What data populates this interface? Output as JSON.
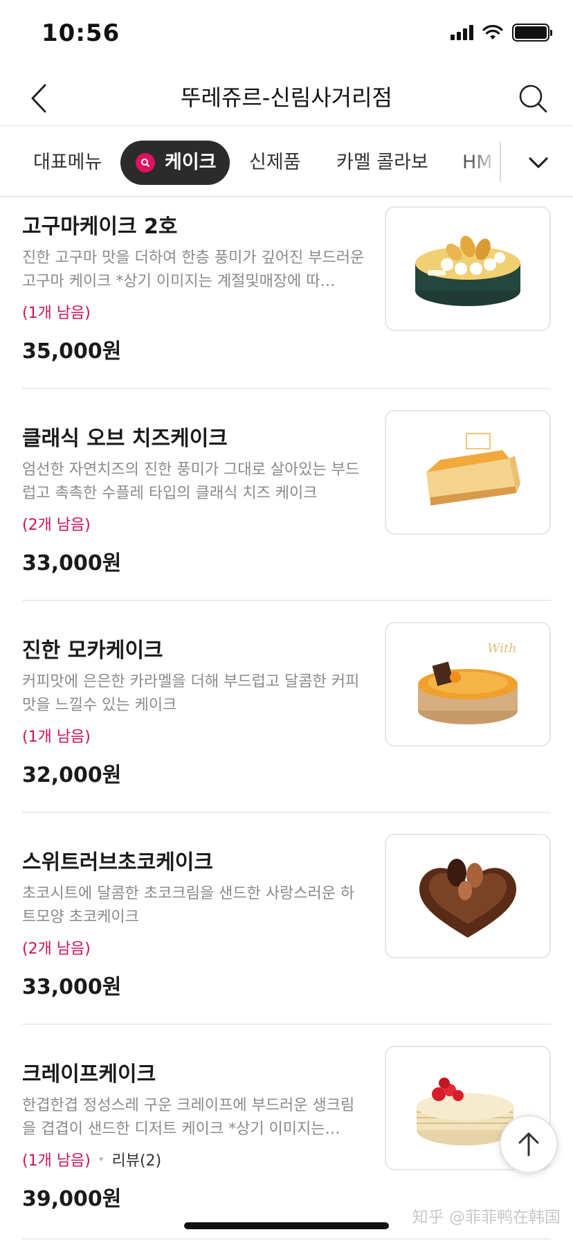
{
  "status_bar": {
    "time": "10:56"
  },
  "header": {
    "title": "뚜레쥬르-신림사거리점"
  },
  "tabs": [
    {
      "label": "대표메뉴"
    },
    {
      "label": "케이크"
    },
    {
      "label": "신제품"
    },
    {
      "label": "카멜 콜라보"
    },
    {
      "label": "HM"
    }
  ],
  "items": [
    {
      "name": "고구마케이크 2호",
      "desc": "진한 고구마 맛을 더하여 한층 풍미가 깊어진 부드러운 고구마 케이크 *상기 이미지는 계절및매장에 따…",
      "stock": "(1개 남음)",
      "price": "35,000원"
    },
    {
      "name": "클래식 오브 치즈케이크",
      "desc": "엄선한 자연치즈의 진한 풍미가 그대로 살아있는 부드럽고 촉촉한 수플레 타입의 클래식 치즈 케이크",
      "stock": "(2개 남음)",
      "price": "33,000원"
    },
    {
      "name": "진한 모카케이크",
      "desc": "커피맛에 은은한 카라멜을 더해 부드럽고 달콤한 커피맛을 느낄수 있는 케이크",
      "stock": "(1개 남음)",
      "price": "32,000원"
    },
    {
      "name": "스위트러브초코케이크",
      "desc": "초코시트에 달콤한 초코크림을 샌드한 사랑스러운 하트모양 초코케이크",
      "stock": "(2개 남음)",
      "price": "33,000원"
    },
    {
      "name": "크레이프케이크",
      "desc": "한겹한겹 정성스레 구운 크레이프에 부드러운 생크림을 겹겹이 샌드한 디저트 케이크 *상기 이미지는…",
      "stock": "(1개 남음)",
      "review": "리뷰(2)",
      "price": "39,000원"
    }
  ],
  "watermark": "知乎 @菲菲鸭在韩国",
  "colors": {
    "accent": "#d0105a",
    "active_tab": "#2b2b2b"
  }
}
